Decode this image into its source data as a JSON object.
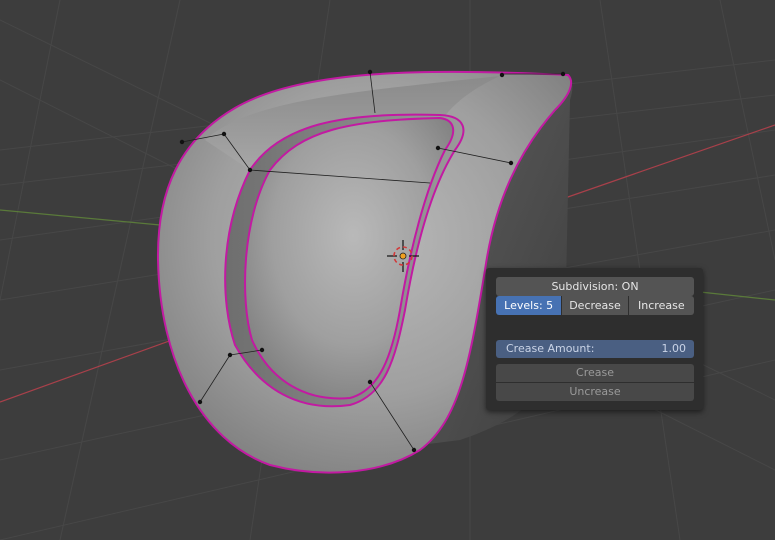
{
  "panel": {
    "subdivision_label": "Subdivision: ON",
    "levels_label": "Levels: 5",
    "decrease_label": "Decrease",
    "increase_label": "Increase",
    "crease_amount_label": "Crease Amount:",
    "crease_amount_value": "1.00",
    "crease_label": "Crease",
    "uncrease_label": "Uncrease"
  },
  "colors": {
    "viewport_bg": "#3d3d3d",
    "grid_line": "#484848",
    "x_axis": "#a8404a",
    "y_axis": "#5a7a3a",
    "selection_outline": "#c21aa2",
    "active_button": "#4772b3",
    "panel_bg": "#2e2e2e"
  },
  "icons": {
    "cursor": "3d-cursor-icon"
  }
}
